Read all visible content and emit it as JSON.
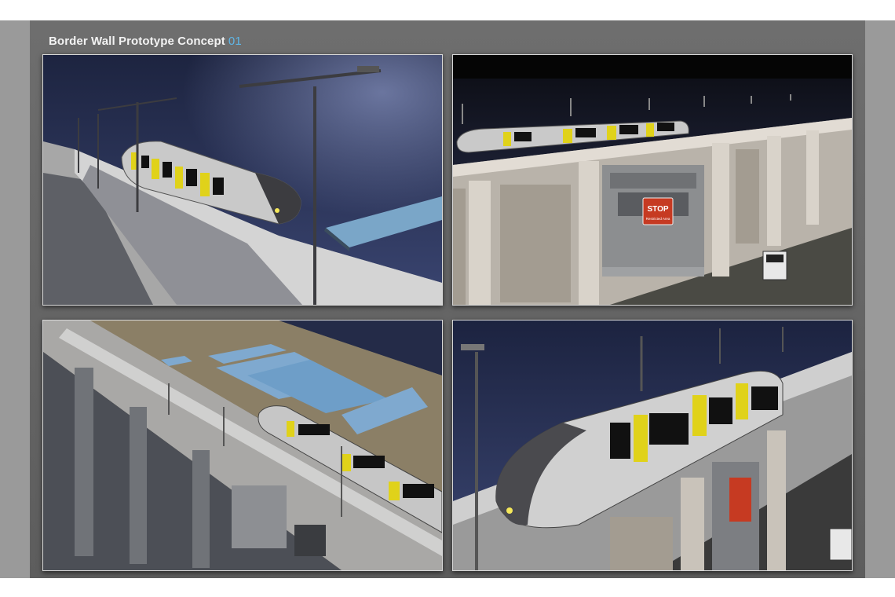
{
  "header": {
    "title": "Border Wall Prototype Concept",
    "number": "01"
  },
  "panels": [
    {
      "id": "panel-1",
      "subject": "monorail-top-view"
    },
    {
      "id": "panel-2",
      "subject": "wall-side-view"
    },
    {
      "id": "panel-3",
      "subject": "aerial-solar-view"
    },
    {
      "id": "panel-4",
      "subject": "monorail-closeup"
    }
  ],
  "signs": {
    "stop": "STOP",
    "restricted": "Restricted Area"
  },
  "colors": {
    "board": "#666666",
    "title": "#f2f2f2",
    "accent_number": "#5fb6e6",
    "night_sky": "#2a3358",
    "train_body": "#c9c9c9",
    "door_yellow": "#e0d21a",
    "sign_red": "#c63a22"
  }
}
